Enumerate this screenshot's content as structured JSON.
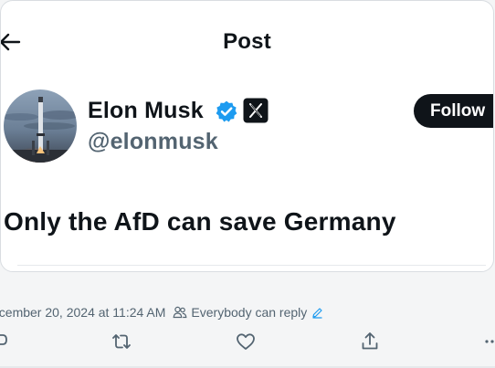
{
  "header": {
    "title": "Post",
    "back_icon": "arrow-left-icon"
  },
  "author": {
    "display_name": "Elon Musk",
    "handle": "@elonmusk",
    "verified_color": "#1d9bf0",
    "badge_icon": "x-logo-icon",
    "avatar_icon": "rocket-launch-photo"
  },
  "follow_button": {
    "label": "Follow"
  },
  "tweet": {
    "text": "Only the AfD can save Germany"
  },
  "meta": {
    "timestamp": "ecember 20, 2024 at 11:24 AM",
    "reply_permission": "Everybody can reply",
    "people_icon": "people-icon",
    "edit_icon": "pencil-icon"
  },
  "actions": {
    "reply_icon": "reply-icon",
    "repost_icon": "repost-icon",
    "like_icon": "heart-icon",
    "share_icon": "share-icon",
    "more_icon": "more-icon"
  },
  "colors": {
    "text_primary": "#0f1419",
    "text_secondary": "#536471",
    "follow_bg": "#0f1419",
    "follow_text": "#ffffff",
    "background": "#f4f5f6"
  }
}
